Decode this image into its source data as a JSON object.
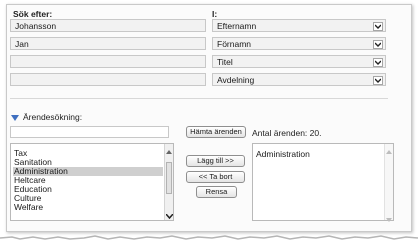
{
  "search": {
    "label": "Sök efter:",
    "inputs": [
      "Johansson",
      "Jan",
      "",
      ""
    ]
  },
  "in": {
    "label": "I:",
    "selects": [
      "Efternamn",
      "Förnamn",
      "Titel",
      "Avdelning"
    ]
  },
  "case_search": {
    "label": "Ärendesökning:",
    "filter_value": "",
    "fetch_button": "Hämta ärenden",
    "count_text": "Antal ärenden: 20.",
    "available_items": [
      {
        "label": "Tax",
        "selected": false
      },
      {
        "label": "Sanitation",
        "selected": false
      },
      {
        "label": "Administration",
        "selected": true
      },
      {
        "label": "Heltcare",
        "selected": false
      },
      {
        "label": "Education",
        "selected": false
      },
      {
        "label": "Culture",
        "selected": false
      },
      {
        "label": "Welfare",
        "selected": false
      }
    ],
    "add_button": "Lägg till >>",
    "remove_button": "<< Ta bort",
    "clear_button": "Rensa",
    "chosen_items": [
      "Administration"
    ]
  }
}
